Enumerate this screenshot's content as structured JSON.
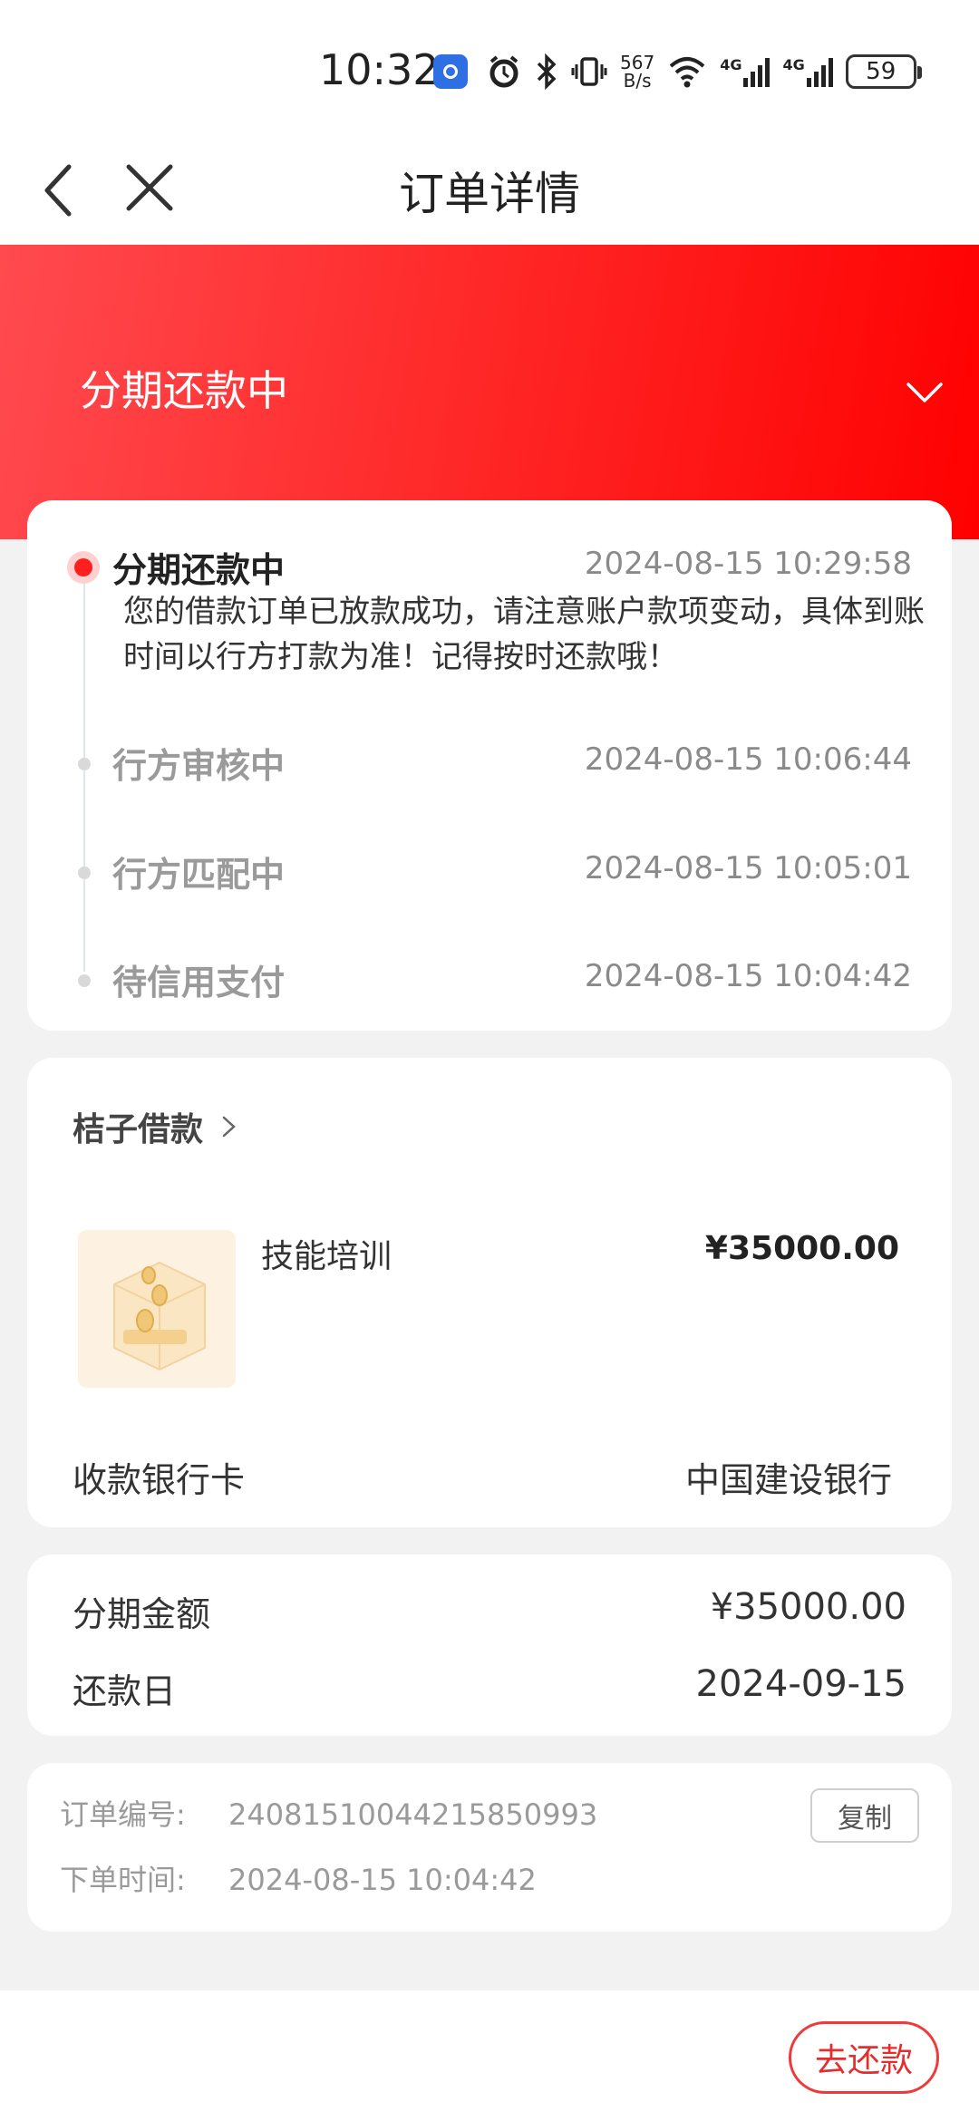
{
  "status_bar": {
    "time": "10:32",
    "speed_top": "567",
    "speed_bottom": "B/s",
    "network1": "4G",
    "network2": "4G",
    "battery": "59",
    "icons": [
      "app-icon",
      "alarm-icon",
      "bluetooth-icon",
      "vibrate-icon",
      "wifi-icon",
      "signal-icon",
      "signal-icon",
      "battery-icon"
    ]
  },
  "nav": {
    "title": "订单详情"
  },
  "header": {
    "status_title": "分期还款中"
  },
  "timeline": [
    {
      "status": "分期还款中",
      "time": "2024-08-15 10:29:58",
      "desc": "您的借款订单已放款成功，请注意账户款项变动，具体到账时间以行方打款为准！记得按时还款哦！",
      "active": true
    },
    {
      "status": "行方审核中",
      "time": "2024-08-15 10:06:44"
    },
    {
      "status": "行方匹配中",
      "time": "2024-08-15 10:05:01"
    },
    {
      "status": "待信用支付",
      "time": "2024-08-15 10:04:42"
    }
  ],
  "product": {
    "merchant": "桔子借款",
    "name": "技能培训",
    "price": "¥35000.00",
    "bank_label": "收款银行卡",
    "bank_value": "中国建设银行"
  },
  "installment": {
    "amount_label": "分期金额",
    "amount_value": "¥35000.00",
    "due_label": "还款日",
    "due_value": "2024-09-15"
  },
  "order": {
    "number_label": "订单编号:",
    "number_value": "24081510044215850993",
    "copy_label": "复制",
    "time_label": "下单时间:",
    "time_value": "2024-08-15 10:04:42"
  },
  "actions": {
    "repay_label": "去还款"
  },
  "colors": {
    "brand_red": "#ff1f1f",
    "header_gradient_start": "#ff4a4f",
    "header_gradient_end": "#ff0000",
    "background": "#f2f2f2"
  }
}
